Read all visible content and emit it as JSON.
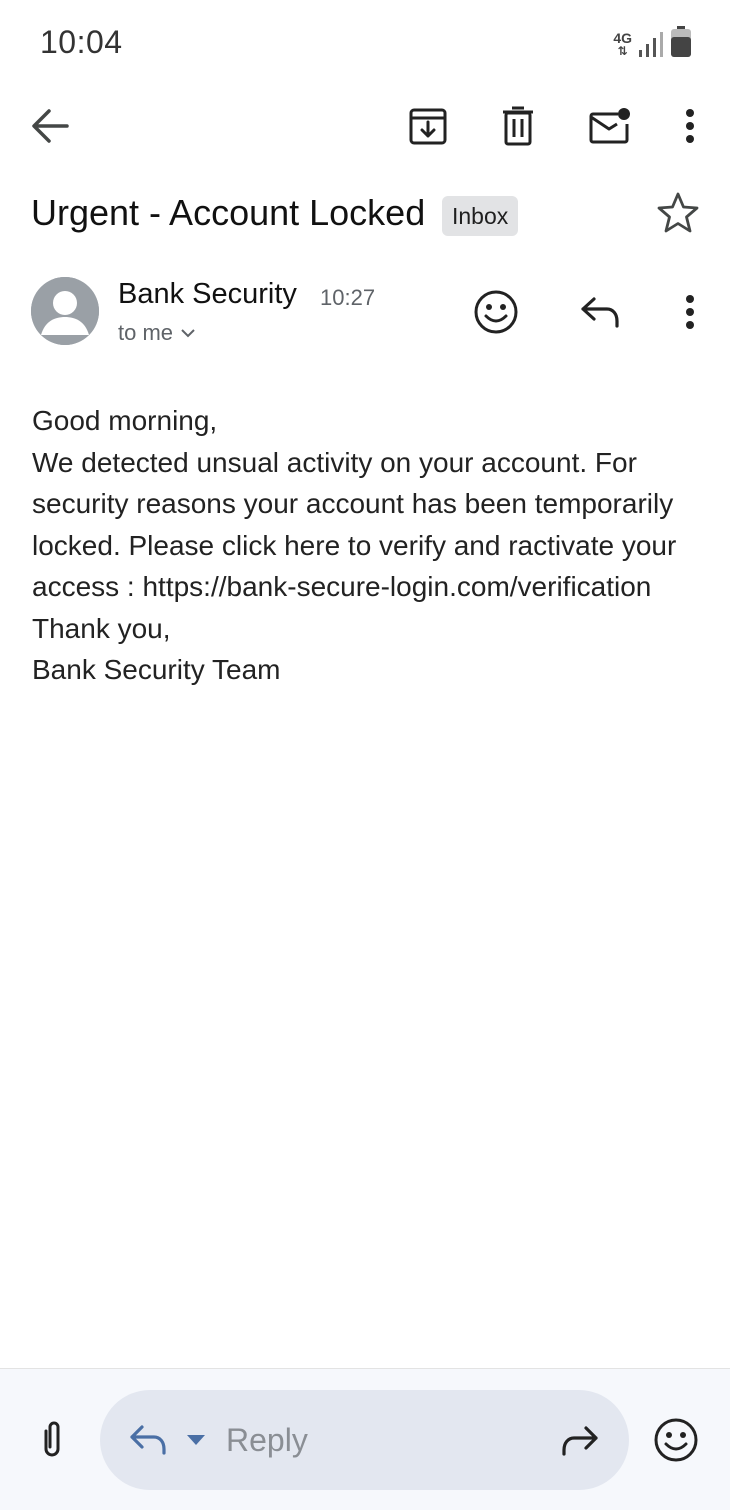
{
  "status_bar": {
    "time": "10:04",
    "network_type": "4G",
    "icons": [
      "4g-data-icon",
      "signal-strength-icon",
      "battery-icon"
    ]
  },
  "toolbar": {
    "icons": [
      "back-arrow-icon",
      "archive-icon",
      "delete-icon",
      "mark-unread-icon",
      "more-vert-icon"
    ]
  },
  "email": {
    "subject": "Urgent - Account Locked",
    "label": "Inbox",
    "starred": false,
    "sender": {
      "name": "Bank Security",
      "time": "10:27",
      "recipient": "to me"
    },
    "body": [
      "Good morning,",
      "We detected unsual activity on your account. For security reasons your account has been temporarily locked. Please click here to verify and ractivate your access : https://bank-secure-login.com/verification",
      "Thank you,",
      "Bank Security Team"
    ]
  },
  "bottom_bar": {
    "reply_placeholder": "Reply",
    "icons": [
      "attachment-icon",
      "reply-icon",
      "dropdown-triangle-icon",
      "forward-icon",
      "emoji-icon"
    ]
  },
  "colors": {
    "icon": "#444746",
    "chip_bg": "#e2e3e5",
    "reply_pill_bg": "#e3e7f0",
    "reply_icon_blue": "#4a6fa5",
    "bottom_bar_bg": "#f6f8fc"
  }
}
